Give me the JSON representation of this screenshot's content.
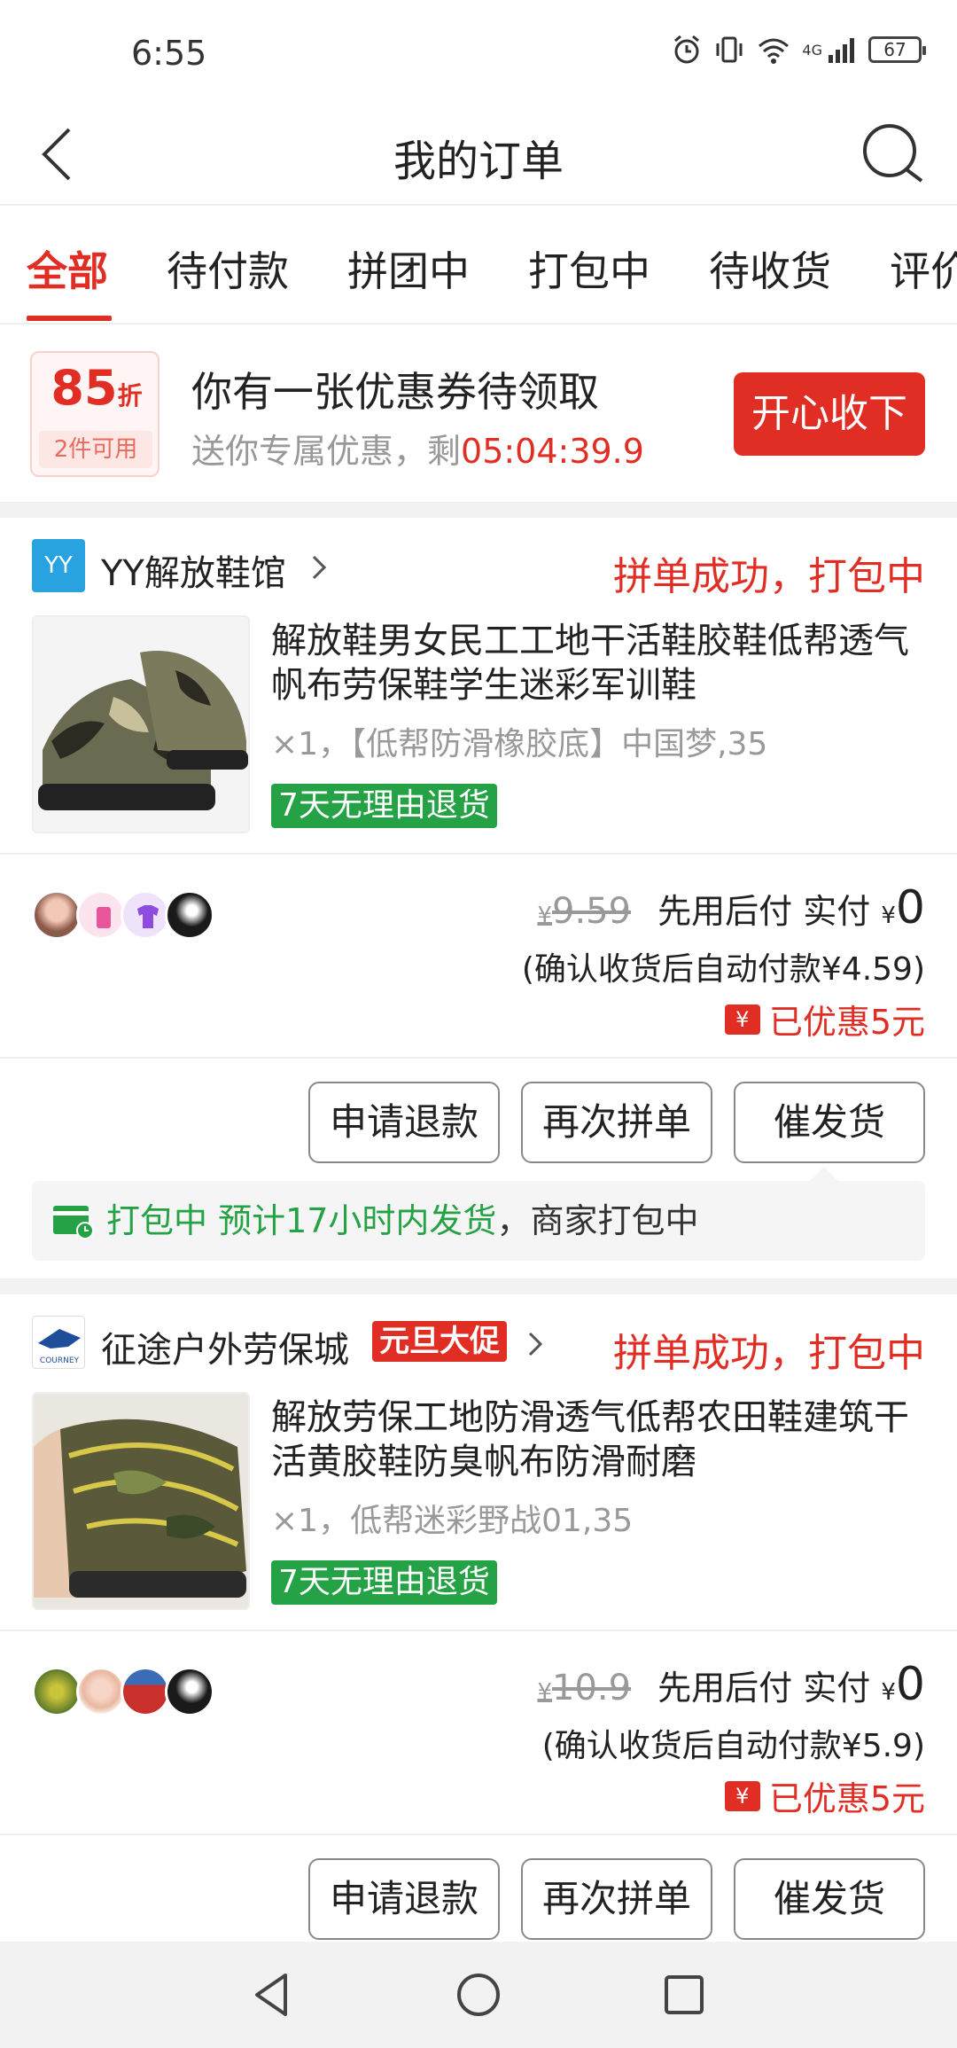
{
  "status_bar": {
    "time": "6:55",
    "battery": "67",
    "network": "4G"
  },
  "header": {
    "title": "我的订单"
  },
  "tabs": [
    {
      "label": "全部",
      "active": true
    },
    {
      "label": "待付款",
      "active": false
    },
    {
      "label": "拼团中",
      "active": false
    },
    {
      "label": "打包中",
      "active": false
    },
    {
      "label": "待收货",
      "active": false
    },
    {
      "label": "评价",
      "active": false
    }
  ],
  "coupon": {
    "discount_num": "85",
    "discount_unit": "折",
    "condition": "2件可用",
    "title": "你有一张优惠券待领取",
    "subtitle": "送你专属优惠，剩",
    "timer": "05:04:39.9",
    "button": "开心收下"
  },
  "orders": [
    {
      "shop_logo_text": "YY",
      "shop_name": "YY解放鞋馆",
      "status": "拼单成功，打包中",
      "product_title": "解放鞋男女民工工地干活鞋胶鞋低帮透气帆布劳保鞋学生迷彩军训鞋",
      "spec": "×1，【低帮防滑橡胶底】中国梦,35",
      "return_tag": "7天无理由退货",
      "orig_price": "9.59",
      "yen": "¥",
      "pay_method": "先用后付 实付",
      "paid": "0",
      "confirm_note": "(确认收货后自动付款¥4.59)",
      "discount_icon": "¥",
      "discount": "已优惠5元",
      "actions": [
        "申请退款",
        "再次拼单",
        "催发货"
      ],
      "ship_status": "打包中 预计17小时内发货",
      "ship_detail": "，商家打包中"
    },
    {
      "shop_logo_text": "COURNEY",
      "shop_name": "征途户外劳保城",
      "promo": "元旦大促",
      "status": "拼单成功，打包中",
      "product_title": "解放劳保工地防滑透气低帮农田鞋建筑干活黄胶鞋防臭帆布防滑耐磨",
      "spec": "×1，低帮迷彩野战01,35",
      "return_tag": "7天无理由退货",
      "orig_price": "10.9",
      "yen": "¥",
      "pay_method": "先用后付 实付",
      "paid": "0",
      "confirm_note": "(确认收货后自动付款¥5.9)",
      "discount_icon": "¥",
      "discount": "已优惠5元",
      "actions": [
        "申请退款",
        "再次拼单",
        "催发货"
      ]
    }
  ],
  "colors": {
    "accent": "#e02e24",
    "green": "#25a245",
    "text": "#222222",
    "muted": "#999999"
  },
  "icons": [
    "back-arrow-icon",
    "search-icon",
    "chevron-right-icon",
    "shipping-box-icon",
    "nav-back-icon",
    "nav-home-icon",
    "nav-recent-icon"
  ]
}
